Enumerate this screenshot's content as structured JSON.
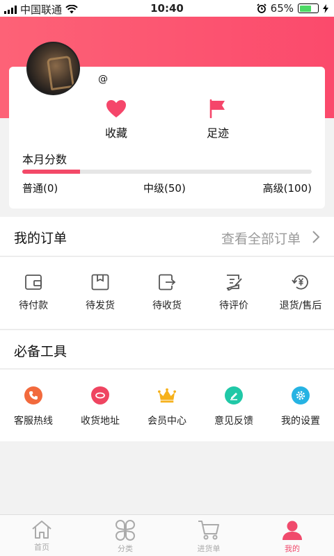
{
  "status_bar": {
    "carrier": "中国联通",
    "time": "10:40",
    "battery": "65%",
    "battery_level": 0.65
  },
  "profile": {
    "username": "@",
    "favorites_label": "收藏",
    "footprint_label": "足迹",
    "score_title": "本月分数",
    "score_progress": 0.2,
    "levels": [
      "普通(0)",
      "中级(50)",
      "高级(100)"
    ]
  },
  "orders": {
    "title": "我的订单",
    "view_all": "查看全部订单",
    "items": [
      {
        "label": "待付款",
        "icon": "wallet-icon"
      },
      {
        "label": "待发货",
        "icon": "package-icon"
      },
      {
        "label": "待收货",
        "icon": "receive-icon"
      },
      {
        "label": "待评价",
        "icon": "review-icon"
      },
      {
        "label": "退货/售后",
        "icon": "refund-icon"
      }
    ]
  },
  "tools": {
    "title": "必备工具",
    "items": [
      {
        "label": "客服热线",
        "icon": "phone-icon",
        "color": "#f26a3d"
      },
      {
        "label": "收货地址",
        "icon": "location-icon",
        "color": "#ef4561"
      },
      {
        "label": "会员中心",
        "icon": "crown-icon",
        "color": "#f6b11b"
      },
      {
        "label": "意见反馈",
        "icon": "edit-icon",
        "color": "#20c8a7"
      },
      {
        "label": "我的设置",
        "icon": "settings-icon",
        "color": "#26b3e3"
      }
    ]
  },
  "tabbar": {
    "items": [
      {
        "label": "首页",
        "icon": "home-icon"
      },
      {
        "label": "分类",
        "icon": "category-icon"
      },
      {
        "label": "进货单",
        "icon": "cart-icon"
      },
      {
        "label": "我的",
        "icon": "user-icon"
      }
    ],
    "active_index": 3,
    "active_color": "#f04a6c"
  },
  "colors": {
    "brand": "#fb4a6c",
    "accent_progress": "#f34968"
  }
}
